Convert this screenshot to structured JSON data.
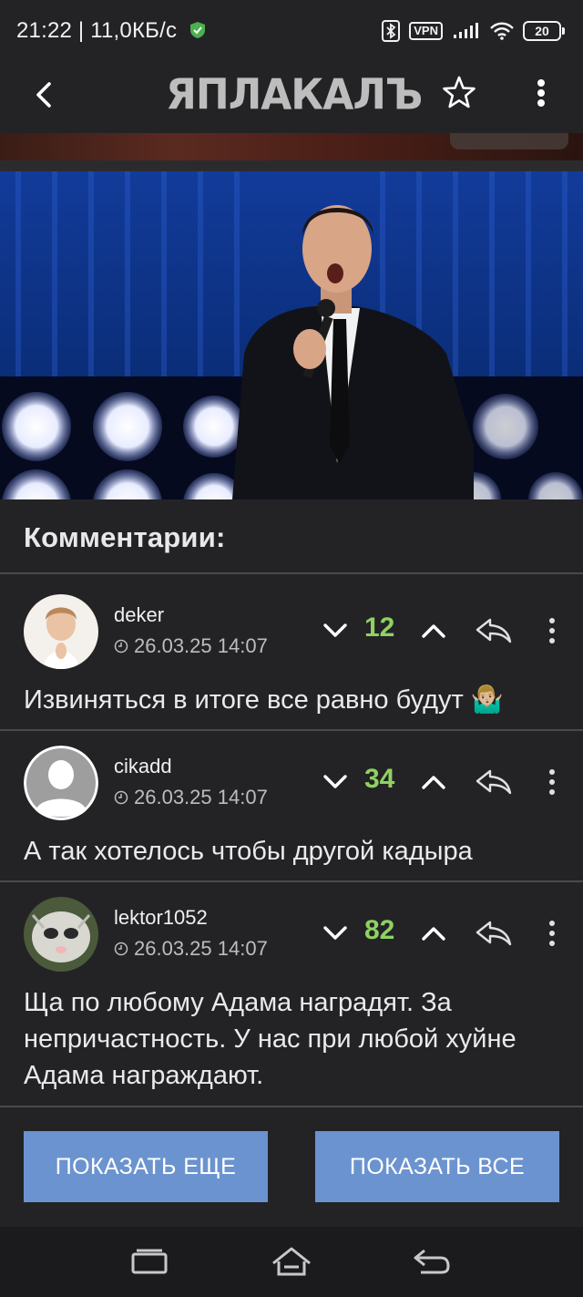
{
  "status_bar": {
    "time_speed": "21:22 | 11,0КБ/с",
    "vpn_label": "VPN",
    "battery": "20"
  },
  "app_bar": {
    "logo_text": "ЯПЛАКАЛЪ"
  },
  "comments": {
    "title": "Комментарии:",
    "items": [
      {
        "username": "deker",
        "timestamp": "26.03.25 14:07",
        "score": "12",
        "text": "Извиняться в итоге все равно будут 🤷🏼‍♂️"
      },
      {
        "username": "cikadd",
        "timestamp": "26.03.25 14:07",
        "score": "34",
        "text": "А так хотелось чтобы другой кадыра"
      },
      {
        "username": "lektor1052",
        "timestamp": "26.03.25 14:07",
        "score": "82",
        "text": "Ща по любому Адама наградят. За непричастность. У нас при любой хуйне Адама награждают."
      }
    ]
  },
  "buttons": {
    "show_more": "ПОКАЗАТЬ ЕЩЕ",
    "show_all": "ПОКАЗАТЬ ВСЕ"
  },
  "colors": {
    "background": "#232326",
    "score_green": "#8fd162",
    "button_blue": "#6b93cf"
  },
  "icons": [
    "shield-check-icon",
    "bluetooth-icon",
    "signal-icon",
    "wifi-icon",
    "battery-icon",
    "back-arrow-icon",
    "star-icon",
    "more-vert-icon",
    "clock-icon",
    "chevron-down-icon",
    "chevron-up-icon",
    "reply-icon",
    "recents-icon",
    "home-icon",
    "nav-back-icon"
  ]
}
